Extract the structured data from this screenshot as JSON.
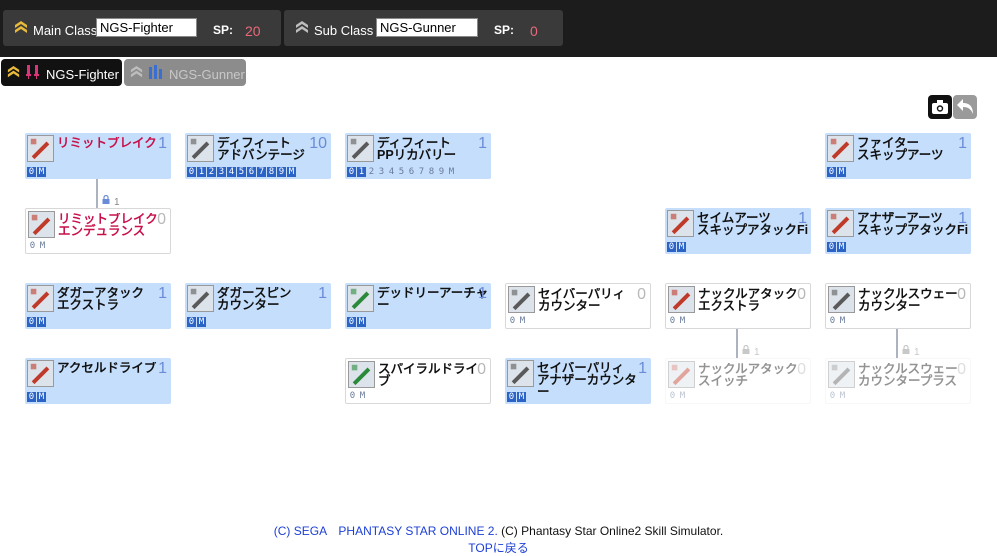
{
  "header": {
    "main": {
      "label": "Main Class",
      "value": "NGS-Fighter",
      "sp_label": "SP:",
      "sp_value": "20"
    },
    "sub": {
      "label": "Sub  Class",
      "value": "NGS-Gunner",
      "sp_label": "SP:",
      "sp_value": "0"
    }
  },
  "tabs": [
    {
      "label": "NGS-Fighter",
      "active": true
    },
    {
      "label": "NGS-Gunner",
      "active": false
    }
  ],
  "toolbar": {
    "screenshot_icon": "camera-icon",
    "undo_icon": "undo-icon"
  },
  "skills": [
    {
      "name": "リミットブレイク",
      "level": "1",
      "red": true,
      "state": "on",
      "levels": [
        "0",
        "M"
      ]
    },
    {
      "name": "ディフィート\nアドバンテージ",
      "level": "10",
      "state": "on",
      "levels": [
        "0",
        "1",
        "2",
        "3",
        "4",
        "5",
        "6",
        "7",
        "8",
        "9",
        "M"
      ]
    },
    {
      "name": "ディフィート\nPPリカバリー",
      "level": "1",
      "state": "on",
      "levels": [
        "0",
        "1",
        "2",
        "3",
        "4",
        "5",
        "6",
        "7",
        "8",
        "9",
        "M"
      ]
    },
    {
      "name": "ファイター\nスキップアーツ",
      "level": "1",
      "state": "on",
      "levels": [
        "0",
        "M"
      ]
    },
    {
      "name": "リミットブレイク\nエンデュランス",
      "level": "0",
      "red": true,
      "state": "off",
      "levels": [
        "0",
        "M"
      ]
    },
    {
      "name": "セイムアーツ\nスキップアタックFi",
      "level": "1",
      "state": "on",
      "levels": [
        "0",
        "M"
      ]
    },
    {
      "name": "アナザーアーツ\nスキップアタックFi",
      "level": "1",
      "state": "on",
      "levels": [
        "0",
        "M"
      ]
    },
    {
      "name": "ダガーアタック\nエクストラ",
      "level": "1",
      "state": "on",
      "levels": [
        "0",
        "M"
      ]
    },
    {
      "name": "ダガースピン\nカウンター",
      "level": "1",
      "state": "on",
      "levels": [
        "0",
        "M"
      ]
    },
    {
      "name": "デッドリーアーチャ\nー",
      "level": "1",
      "state": "on",
      "levels": [
        "0",
        "M"
      ]
    },
    {
      "name": "セイバーパリィ\nカウンター",
      "level": "0",
      "state": "off",
      "levels": [
        "0",
        "M"
      ]
    },
    {
      "name": "ナックルアタック\nエクストラ",
      "level": "0",
      "state": "off",
      "levels": [
        "0",
        "M"
      ]
    },
    {
      "name": "ナックルスウェー\nカウンター",
      "level": "0",
      "state": "off",
      "levels": [
        "0",
        "M"
      ]
    },
    {
      "name": "アクセルドライブ",
      "level": "1",
      "state": "on",
      "levels": [
        "0",
        "M"
      ]
    },
    {
      "name": "スパイラルドライブ",
      "level": "0",
      "state": "off",
      "levels": [
        "0",
        "M"
      ]
    },
    {
      "name": "セイバーパリィ\nアナザーカウンター",
      "level": "1",
      "state": "on",
      "levels": [
        "0",
        "M"
      ]
    },
    {
      "name": "ナックルアタック\nスイッチ",
      "level": "0",
      "state": "locked",
      "levels": [
        "0",
        "M"
      ]
    },
    {
      "name": "ナックルスウェー\nカウンタープラス",
      "level": "0",
      "state": "locked",
      "levels": [
        "0",
        "M"
      ]
    }
  ],
  "locks": [
    {
      "value": "1"
    },
    {
      "value": "1"
    },
    {
      "value": "1"
    }
  ],
  "footer": {
    "copyright": "(C)  SEGA　PHANTASY STAR ONLINE 2.",
    "copyright2": " (C) Phantasy Star Online2 Skill Simulator.",
    "top_link": "TOPに戻る"
  },
  "colors": {
    "accent_blue": "#c4defb",
    "sp_red": "#e86a7a",
    "name_red": "#c8104a"
  }
}
